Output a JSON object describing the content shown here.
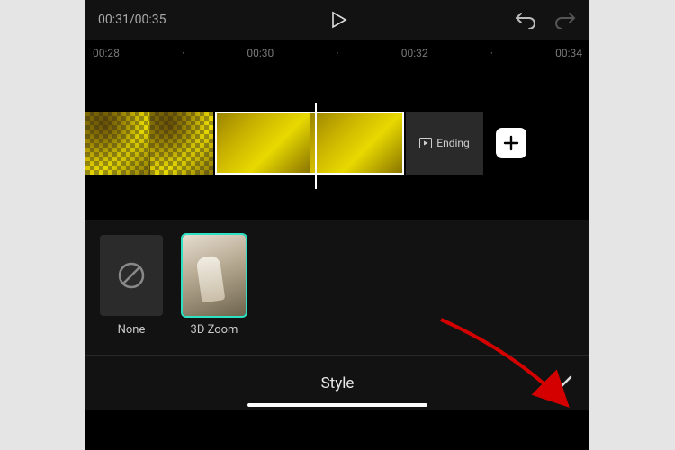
{
  "topbar": {
    "current_time": "00:31",
    "total_time": "00:35"
  },
  "ruler": {
    "ticks": [
      "00:28",
      "00:30",
      "00:32",
      "00:34"
    ]
  },
  "timeline": {
    "ending_label": "Ending"
  },
  "styles": {
    "items": [
      {
        "label": "None"
      },
      {
        "label": "3D Zoom"
      }
    ]
  },
  "bottom": {
    "title": "Style"
  }
}
